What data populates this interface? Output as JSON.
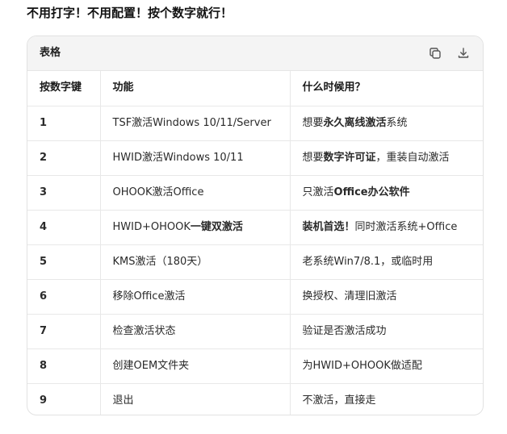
{
  "headline": "不用打字！不用配置！按个数字就行！",
  "table": {
    "title": "表格",
    "icons": {
      "copy": "copy-icon",
      "download": "download-icon"
    },
    "headers": [
      "按数字键",
      "功能",
      "什么时候用？"
    ],
    "rows": [
      {
        "key": "1",
        "function": [
          {
            "t": "TSF激活Windows 10/11/Server",
            "b": false
          }
        ],
        "when": [
          {
            "t": "想要",
            "b": false
          },
          {
            "t": "永久离线激活",
            "b": true
          },
          {
            "t": "系统",
            "b": false
          }
        ]
      },
      {
        "key": "2",
        "function": [
          {
            "t": "HWID激活Windows 10/11",
            "b": false
          }
        ],
        "when": [
          {
            "t": "想要",
            "b": false
          },
          {
            "t": "数字许可证",
            "b": true
          },
          {
            "t": "，重装自动激活",
            "b": false
          }
        ]
      },
      {
        "key": "3",
        "function": [
          {
            "t": "OHOOK激活Office",
            "b": false
          }
        ],
        "when": [
          {
            "t": "只激活",
            "b": false
          },
          {
            "t": "Office办公软件",
            "b": true
          }
        ]
      },
      {
        "key": "4",
        "function": [
          {
            "t": "HWID+OHOOK",
            "b": false
          },
          {
            "t": "一键双激活",
            "b": true
          }
        ],
        "when": [
          {
            "t": "装机首选！",
            "b": true
          },
          {
            "t": "同时激活系统+Office",
            "b": false
          }
        ]
      },
      {
        "key": "5",
        "function": [
          {
            "t": "KMS激活（180天）",
            "b": false
          }
        ],
        "when": [
          {
            "t": "老系统Win7/8.1，或临时用",
            "b": false
          }
        ]
      },
      {
        "key": "6",
        "function": [
          {
            "t": "移除Office激活",
            "b": false
          }
        ],
        "when": [
          {
            "t": "换授权、清理旧激活",
            "b": false
          }
        ]
      },
      {
        "key": "7",
        "function": [
          {
            "t": "检查激活状态",
            "b": false
          }
        ],
        "when": [
          {
            "t": "验证是否激活成功",
            "b": false
          }
        ]
      },
      {
        "key": "8",
        "function": [
          {
            "t": "创建OEM文件夹",
            "b": false
          }
        ],
        "when": [
          {
            "t": "为HWID+OHOOK做适配",
            "b": false
          }
        ]
      },
      {
        "key": "9",
        "function": [
          {
            "t": "退出",
            "b": false
          }
        ],
        "when": [
          {
            "t": "不激活，直接走",
            "b": false
          }
        ]
      }
    ]
  }
}
